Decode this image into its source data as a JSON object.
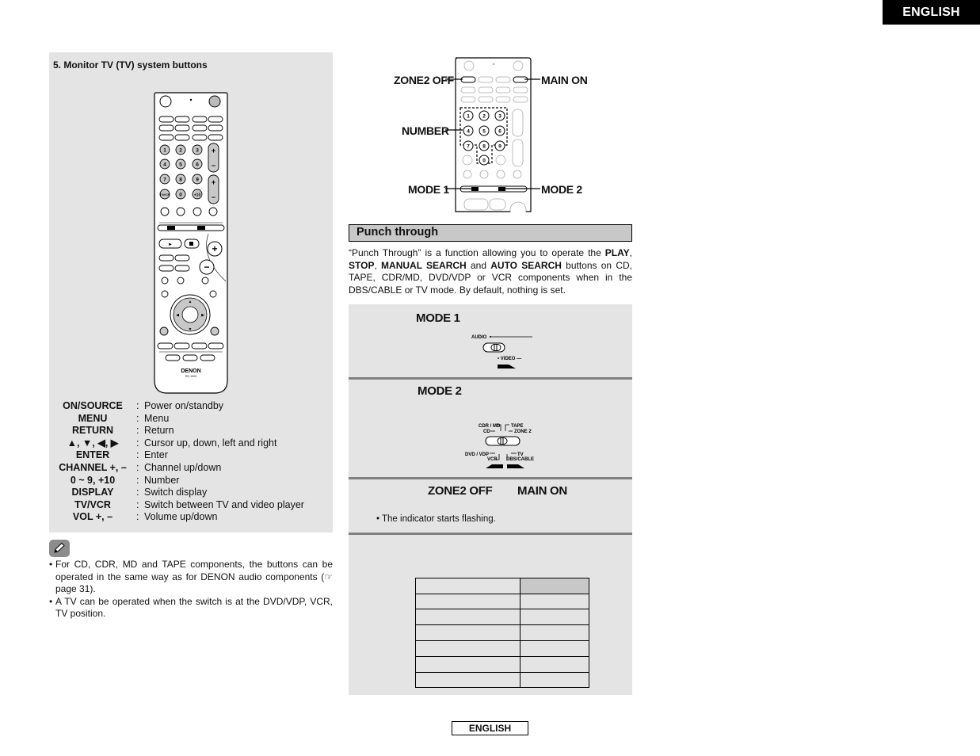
{
  "header": {
    "language_badge": "ENGLISH"
  },
  "left": {
    "section_title": "5.  Monitor TV (TV) system buttons",
    "remote": {
      "brand": "DENON",
      "model": "RC-1003",
      "number_keys": [
        "1",
        "2",
        "3",
        "4",
        "5",
        "6",
        "7",
        "8",
        "9",
        "TV/VCR",
        "0",
        "+10"
      ]
    },
    "button_table": [
      {
        "key": "ON/SOURCE",
        "sep": ":",
        "desc": "Power on/standby"
      },
      {
        "key": "MENU",
        "sep": ":",
        "desc": "Menu"
      },
      {
        "key": "RETURN",
        "sep": ":",
        "desc": "Return"
      },
      {
        "key": "▲, ▼, ◀, ▶",
        "sep": ":",
        "desc": "Cursor up, down, left and right"
      },
      {
        "key": "ENTER",
        "sep": ":",
        "desc": "Enter"
      },
      {
        "key": "CHANNEL +, –",
        "sep": ":",
        "desc": "Channel up/down"
      },
      {
        "key": "0 ~ 9, +10",
        "sep": ":",
        "desc": "Number"
      },
      {
        "key": "DISPLAY",
        "sep": ":",
        "desc": "Switch display"
      },
      {
        "key": "TV/VCR",
        "sep": ":",
        "desc": "Switch between TV and video player"
      },
      {
        "key": "VOL +, –",
        "sep": ":",
        "desc": "Volume up/down"
      }
    ],
    "note_icon": "pencil-icon",
    "notes": [
      {
        "bullet": "•",
        "text": "For CD, CDR, MD and TAPE components, the buttons can be operated in the same way as for DENON audio components (☞ page 31)."
      },
      {
        "bullet": "•",
        "text": "A TV can be operated when the switch is at the DVD/VDP, VCR, TV position."
      }
    ]
  },
  "right": {
    "remote_callouts": {
      "zone2_off": "ZONE2 OFF",
      "main_on": "MAIN ON",
      "number": "NUMBER",
      "mode1": "MODE 1",
      "mode2": "MODE 2"
    },
    "remote_number_keys": [
      "1",
      "2",
      "3",
      "4",
      "5",
      "6",
      "7",
      "8",
      "9",
      "0"
    ],
    "punch_through": {
      "heading": "Punch through",
      "desc_parts": [
        {
          "t": "“Punch Through” is a function allowing you to operate the ",
          "b": false
        },
        {
          "t": "PLAY",
          "b": true
        },
        {
          "t": ", ",
          "b": false
        },
        {
          "t": "STOP",
          "b": true
        },
        {
          "t": ", ",
          "b": false
        },
        {
          "t": "MANUAL SEARCH",
          "b": true
        },
        {
          "t": " and ",
          "b": false
        },
        {
          "t": "AUTO SEARCH",
          "b": true
        },
        {
          "t": " buttons on CD, TAPE, CDR/MD, DVD/VDP or VCR components when in the DBS/CABLE or TV mode. By default, nothing is set.",
          "b": false
        }
      ]
    },
    "steps": {
      "step1": {
        "title": "MODE 1",
        "switch_labels": {
          "top": "AUDIO",
          "bottom": "VIDEO"
        }
      },
      "step2": {
        "title": "MODE 2",
        "switch_labels": {
          "top_left_1": "CDR / MD",
          "top_left_2": "CD",
          "top_right_1": "TAPE",
          "top_right_2": "ZONE 2",
          "bottom_left_1": "DVD / VDP",
          "bottom_left_2": "VCR",
          "bottom_right_1": "TV",
          "bottom_right_2": "DBS/CABLE"
        }
      },
      "step3": {
        "title_a": "ZONE2 OFF",
        "title_b": "MAIN ON",
        "note": "• The indicator starts flashing."
      },
      "step4": {
        "table_rows": [
          [
            "",
            ""
          ],
          [
            "",
            ""
          ],
          [
            "",
            ""
          ],
          [
            "",
            ""
          ],
          [
            "",
            ""
          ],
          [
            "",
            ""
          ],
          [
            "",
            ""
          ]
        ],
        "header_cell_color": "#c8c8c8"
      }
    }
  },
  "footer": {
    "language_badge": "ENGLISH"
  }
}
